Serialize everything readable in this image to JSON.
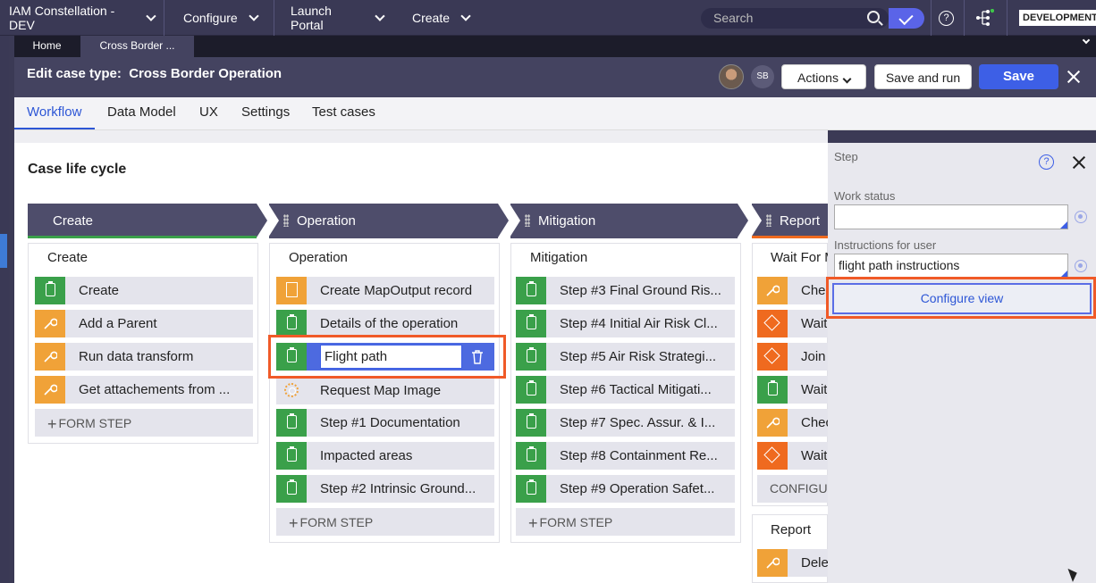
{
  "topnav": {
    "app": "IAM Constellation - DEV",
    "configure": "Configure",
    "launch": "Launch Portal",
    "create": "Create",
    "search_placeholder": "Search",
    "env": "DEVELOPMENT",
    "help": "?"
  },
  "tabs": {
    "home": "Home",
    "cross_border": "Cross Border ..."
  },
  "header": {
    "prefix": "Edit case type:",
    "title": "Cross Border Operation",
    "avatar_initials": "SB",
    "actions": "Actions",
    "save_run": "Save and run",
    "save": "Save"
  },
  "subnav": [
    "Workflow",
    "Data Model",
    "UX",
    "Settings",
    "Test cases"
  ],
  "lifecycle_title": "Case life cycle",
  "stages": {
    "create": {
      "title": "Create",
      "process": "Create",
      "steps": [
        "Create",
        "Add a Parent",
        "Run data transform",
        "Get attachements from ..."
      ],
      "form_step": "FORM STEP"
    },
    "operation": {
      "title": "Operation",
      "process": "Operation",
      "steps": [
        "Create MapOutput record",
        "Details of the operation",
        "Flight path",
        "Request Map Image",
        "Step #1 Documentation",
        "Impacted areas",
        "Step #2 Intrinsic Ground..."
      ],
      "form_step": "FORM STEP"
    },
    "mitigation": {
      "title": "Mitigation",
      "process": "Mitigation",
      "steps": [
        "Step #3 Final Ground Ris...",
        "Step #4 Initial Air Risk Cl...",
        "Step #5 Air Risk Strategi...",
        "Step #6 Tactical Mitigati...",
        "Step #7 Spec. Assur. & I...",
        "Step #8 Containment Re...",
        "Step #9 Operation Safet..."
      ],
      "form_step": "FORM STEP"
    },
    "report": {
      "title": "Report",
      "process": "Wait For M",
      "steps": [
        "Chec",
        "Wait",
        "Join",
        "Wait",
        "Chec",
        "Wait"
      ],
      "configure": "CONFIGUR",
      "process2": "Report",
      "steps2": [
        "Dele"
      ]
    }
  },
  "panel": {
    "title": "Step",
    "help": "?",
    "work_status_label": "Work status",
    "work_status_value": "",
    "instructions_label": "Instructions for user",
    "instructions_value": "flight path instructions",
    "configure_view": "Configure view"
  },
  "colors": {
    "accent": "#3d5fe6",
    "highlight": "#f05a28",
    "green": "#3aa04a",
    "orange": "#f0a238",
    "red": "#ef6a1f"
  }
}
